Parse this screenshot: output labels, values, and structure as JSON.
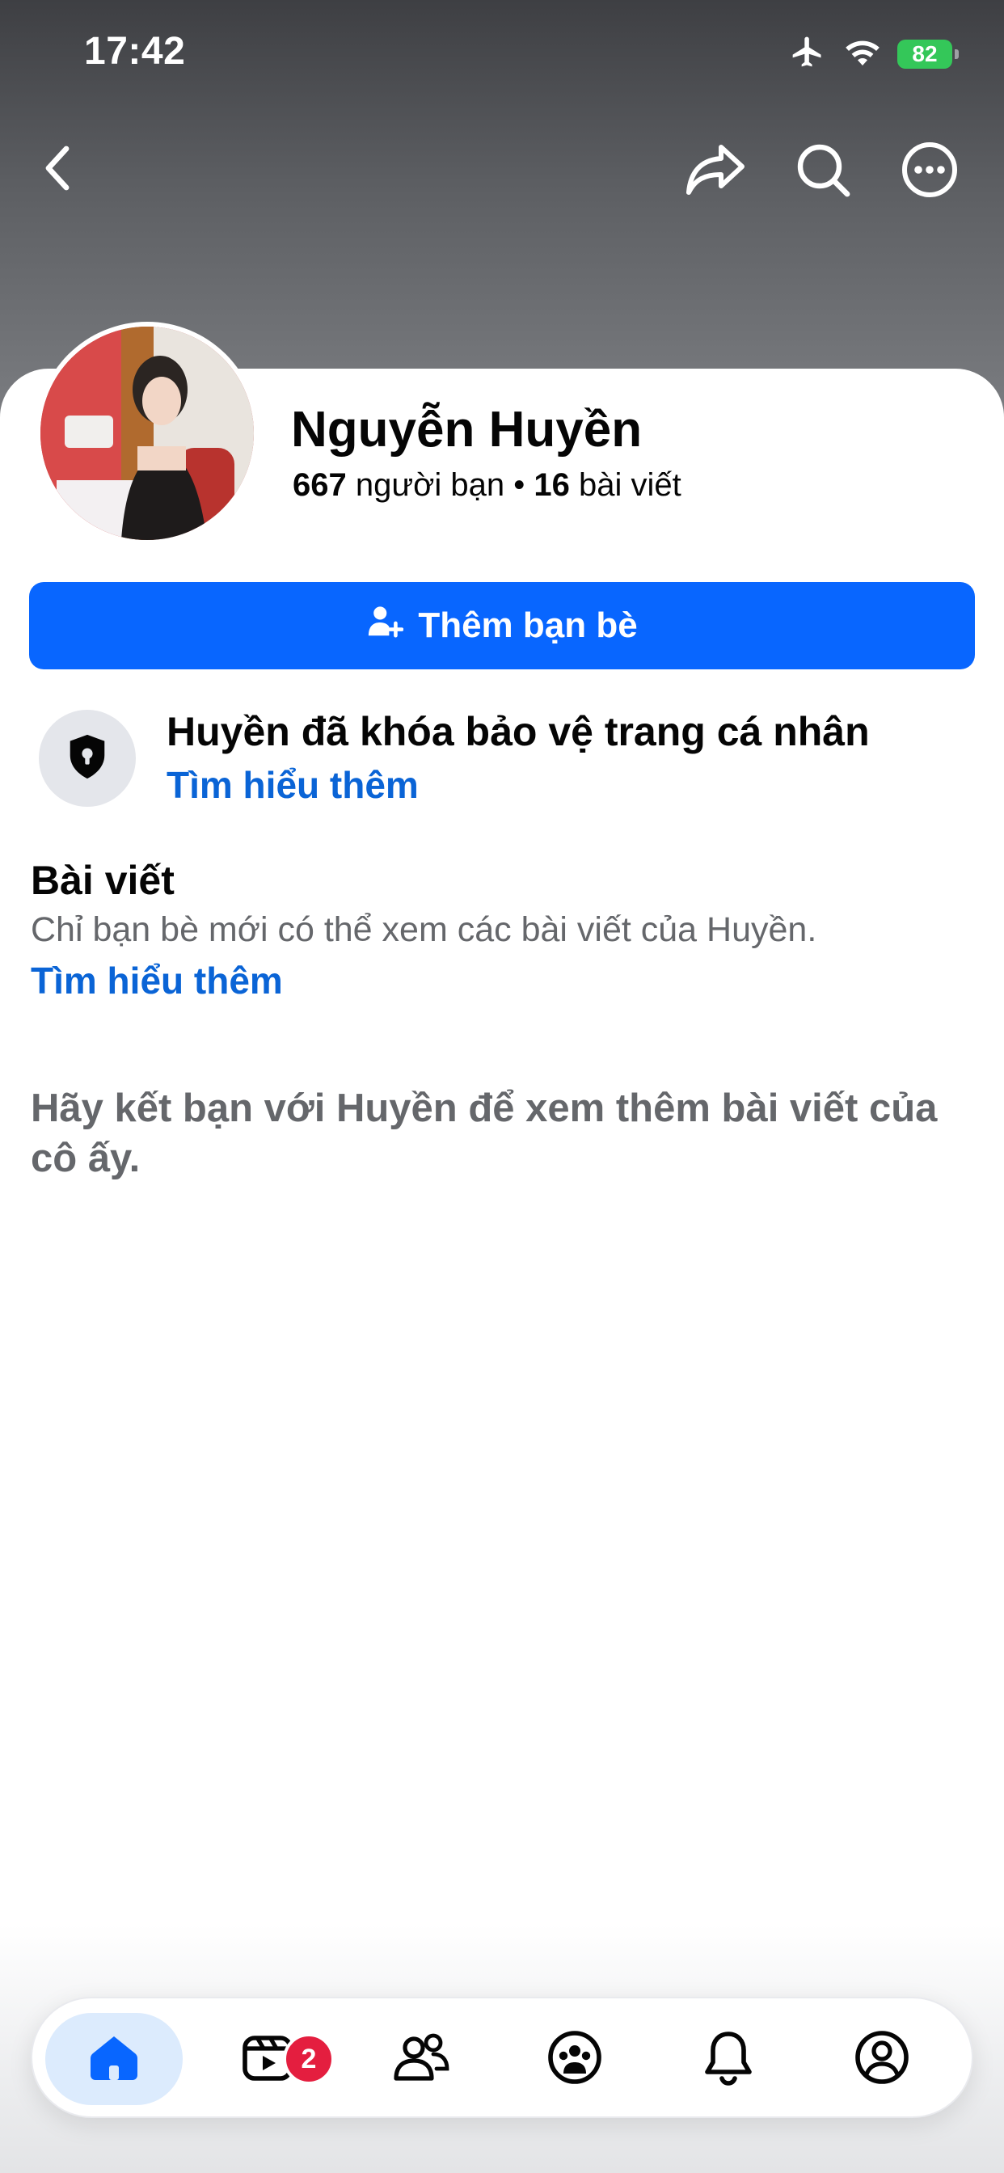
{
  "status_bar": {
    "time": "17:42",
    "battery": "82",
    "icons": [
      "airplane-icon",
      "wifi-icon",
      "battery-icon"
    ]
  },
  "top_nav": {
    "icons": [
      "back-icon",
      "share-icon",
      "search-icon",
      "more-icon"
    ]
  },
  "profile": {
    "name": "Nguyễn Huyền",
    "friends_count": "667",
    "friends_label": "người bạn",
    "separator": "•",
    "posts_count": "16",
    "posts_label": "bài viết"
  },
  "actions": {
    "add_friend_label": "Thêm bạn bè",
    "add_friend_icon": "person-add-icon"
  },
  "privacy": {
    "icon": "shield-lock-icon",
    "title": "Huyền đã khóa bảo vệ trang cá nhân",
    "link": "Tìm hiểu thêm"
  },
  "posts_section": {
    "title": "Bài viết",
    "description": "Chỉ bạn bè mới có thể xem các bài viết của Huyền.",
    "link": "Tìm hiểu thêm",
    "friend_hint": "Hãy kết bạn với Huyền để xem thêm bài viết của cô ấy."
  },
  "tab_bar": {
    "tabs": [
      {
        "icon": "home-icon",
        "active": true
      },
      {
        "icon": "video-icon",
        "badge": "2"
      },
      {
        "icon": "friends-icon"
      },
      {
        "icon": "groups-icon"
      },
      {
        "icon": "bell-icon"
      },
      {
        "icon": "profile-icon"
      }
    ]
  },
  "colors": {
    "primary": "#0866ff",
    "link": "#0a64d6",
    "secondary_text": "#65676b",
    "badge": "#e41e3f",
    "battery": "#34c759"
  }
}
